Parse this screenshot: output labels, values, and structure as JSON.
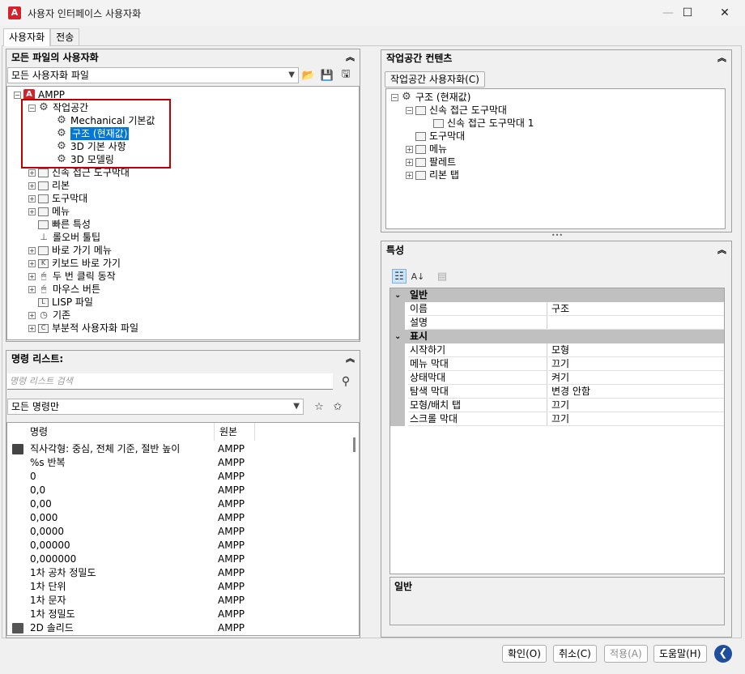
{
  "window": {
    "title": "사용자 인터페이스 사용자화",
    "app_icon": "A"
  },
  "tabs": [
    {
      "label": "사용자화"
    },
    {
      "label": "전송"
    }
  ],
  "all_files_panel": {
    "title": "모든 파일의 사용자화",
    "combo_value": "모든 사용자화 파일",
    "tree": [
      {
        "label": "AMPP"
      },
      {
        "label": "작업공간"
      },
      {
        "label": "Mechanical 기본값"
      },
      {
        "label": "구조 (현재값)"
      },
      {
        "label": "3D 기본 사항"
      },
      {
        "label": "3D 모델링"
      },
      {
        "label": "신속 접근 도구막대"
      },
      {
        "label": "리본"
      },
      {
        "label": "도구막대"
      },
      {
        "label": "메뉴"
      },
      {
        "label": "빠른 특성"
      },
      {
        "label": "롤오버 툴팁"
      },
      {
        "label": "바로 가기 메뉴"
      },
      {
        "label": "키보드 바로 가기"
      },
      {
        "label": "두 번 클릭 동작"
      },
      {
        "label": "마우스 버튼"
      },
      {
        "label": "LISP 파일"
      },
      {
        "label": "기존"
      },
      {
        "label": "부분적 사용자화 파일"
      }
    ]
  },
  "command_list": {
    "title": "명령 리스트:",
    "search_placeholder": "명령 리스트 검색",
    "filter_value": "모든 명령만",
    "columns": [
      "명령",
      "원본"
    ],
    "rows": [
      {
        "name": "직사각형: 중심, 전체 기준, 절반 높이",
        "source": "AMPP"
      },
      {
        "name": "%s 반복",
        "source": "AMPP"
      },
      {
        "name": "0",
        "source": "AMPP"
      },
      {
        "name": "0,0",
        "source": "AMPP"
      },
      {
        "name": "0,00",
        "source": "AMPP"
      },
      {
        "name": "0,000",
        "source": "AMPP"
      },
      {
        "name": "0,0000",
        "source": "AMPP"
      },
      {
        "name": "0,00000",
        "source": "AMPP"
      },
      {
        "name": "0,000000",
        "source": "AMPP"
      },
      {
        "name": "1차 공차 정밀도",
        "source": "AMPP"
      },
      {
        "name": "1차 단위",
        "source": "AMPP"
      },
      {
        "name": "1차 문자",
        "source": "AMPP"
      },
      {
        "name": "1차 정밀도",
        "source": "AMPP"
      },
      {
        "name": "2D 솔리드",
        "source": "AMPP"
      }
    ]
  },
  "workspace_contents": {
    "title": "작업공간 컨텐츠",
    "customize_button": "작업공간 사용자화(C)",
    "tree": [
      {
        "label": "구조 (현재값)"
      },
      {
        "label": "신속 접근 도구막대"
      },
      {
        "label": "신속 접근 도구막대 1"
      },
      {
        "label": "도구막대"
      },
      {
        "label": "메뉴"
      },
      {
        "label": "팔레트"
      },
      {
        "label": "리본 탭"
      }
    ]
  },
  "properties": {
    "title": "특성",
    "categories": [
      {
        "name": "일반",
        "rows": [
          {
            "key": "이름",
            "value": "구조"
          },
          {
            "key": "설명",
            "value": ""
          }
        ]
      },
      {
        "name": "표시",
        "rows": [
          {
            "key": "시작하기",
            "value": "모형"
          },
          {
            "key": "메뉴 막대",
            "value": "끄기"
          },
          {
            "key": "상태막대",
            "value": "켜기"
          },
          {
            "key": "탐색 막대",
            "value": "변경 안함"
          },
          {
            "key": "모형/배치 탭",
            "value": "끄기"
          },
          {
            "key": "스크롤 막대",
            "value": "끄기"
          }
        ]
      }
    ],
    "description_title": "일반"
  },
  "footer": {
    "ok": "확인(O)",
    "cancel": "취소(C)",
    "apply": "적용(A)",
    "help": "도움말(H)"
  },
  "colors": {
    "accent": "#0078d7",
    "highlight": "#c00000",
    "brand": "#d2232a"
  }
}
